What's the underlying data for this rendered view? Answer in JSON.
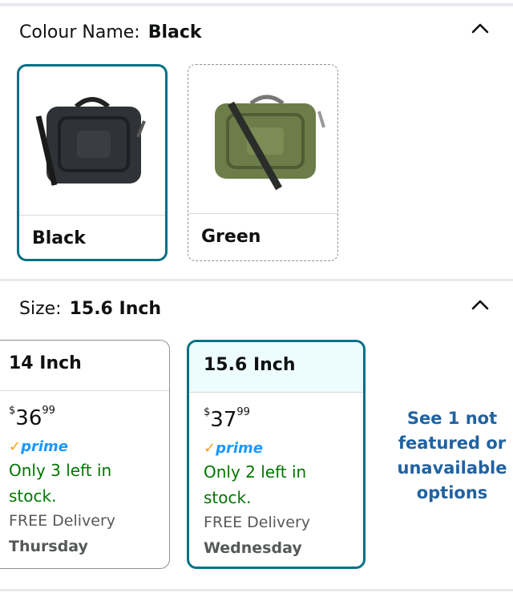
{
  "colour": {
    "label": "Colour Name:",
    "selected": "Black",
    "options": [
      {
        "name": "Black",
        "bag_color": "#2f3236",
        "accent": "#1d1f22"
      },
      {
        "name": "Green",
        "bag_color": "#6d7d4a",
        "accent": "#4f5c35"
      }
    ]
  },
  "size": {
    "label": "Size:",
    "selected": "15.6 Inch",
    "options": [
      {
        "name": "14 Inch",
        "currency": "$",
        "whole": "36",
        "fraction": "99",
        "prime": "prime",
        "stock": "Only 3 left in stock.",
        "delivery": "FREE Delivery",
        "day": "Thursday"
      },
      {
        "name": "15.6 Inch",
        "currency": "$",
        "whole": "37",
        "fraction": "99",
        "prime": "prime",
        "stock": "Only 2 left in stock.",
        "delivery": "FREE Delivery",
        "day": "Wednesday"
      }
    ],
    "see_more": "See 1 not featured or unavailable options"
  },
  "colors": {
    "accent": "#007185",
    "stock_green": "#007600",
    "link_blue": "#2162a1",
    "prime_blue": "#1a98ff"
  }
}
